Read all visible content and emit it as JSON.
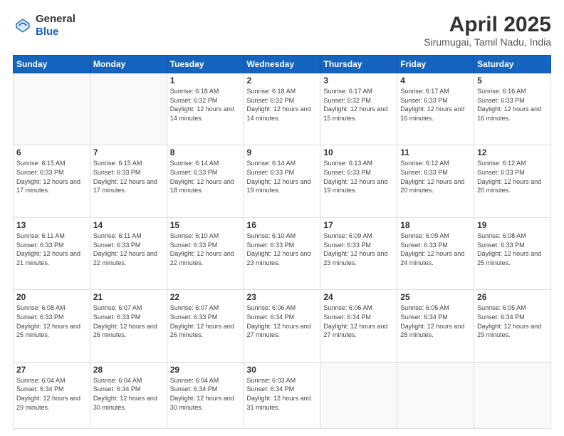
{
  "header": {
    "logo_general": "General",
    "logo_blue": "Blue",
    "title": "April 2025",
    "subtitle": "Sirumugai, Tamil Nadu, India"
  },
  "weekdays": [
    "Sunday",
    "Monday",
    "Tuesday",
    "Wednesday",
    "Thursday",
    "Friday",
    "Saturday"
  ],
  "weeks": [
    [
      {
        "day": "",
        "info": ""
      },
      {
        "day": "",
        "info": ""
      },
      {
        "day": "1",
        "info": "Sunrise: 6:18 AM\nSunset: 6:32 PM\nDaylight: 12 hours and 14 minutes."
      },
      {
        "day": "2",
        "info": "Sunrise: 6:18 AM\nSunset: 6:32 PM\nDaylight: 12 hours and 14 minutes."
      },
      {
        "day": "3",
        "info": "Sunrise: 6:17 AM\nSunset: 6:32 PM\nDaylight: 12 hours and 15 minutes."
      },
      {
        "day": "4",
        "info": "Sunrise: 6:17 AM\nSunset: 6:33 PM\nDaylight: 12 hours and 16 minutes."
      },
      {
        "day": "5",
        "info": "Sunrise: 6:16 AM\nSunset: 6:33 PM\nDaylight: 12 hours and 16 minutes."
      }
    ],
    [
      {
        "day": "6",
        "info": "Sunrise: 6:15 AM\nSunset: 6:33 PM\nDaylight: 12 hours and 17 minutes."
      },
      {
        "day": "7",
        "info": "Sunrise: 6:15 AM\nSunset: 6:33 PM\nDaylight: 12 hours and 17 minutes."
      },
      {
        "day": "8",
        "info": "Sunrise: 6:14 AM\nSunset: 6:33 PM\nDaylight: 12 hours and 18 minutes."
      },
      {
        "day": "9",
        "info": "Sunrise: 6:14 AM\nSunset: 6:33 PM\nDaylight: 12 hours and 19 minutes."
      },
      {
        "day": "10",
        "info": "Sunrise: 6:13 AM\nSunset: 6:33 PM\nDaylight: 12 hours and 19 minutes."
      },
      {
        "day": "11",
        "info": "Sunrise: 6:12 AM\nSunset: 6:33 PM\nDaylight: 12 hours and 20 minutes."
      },
      {
        "day": "12",
        "info": "Sunrise: 6:12 AM\nSunset: 6:33 PM\nDaylight: 12 hours and 20 minutes."
      }
    ],
    [
      {
        "day": "13",
        "info": "Sunrise: 6:11 AM\nSunset: 6:33 PM\nDaylight: 12 hours and 21 minutes."
      },
      {
        "day": "14",
        "info": "Sunrise: 6:11 AM\nSunset: 6:33 PM\nDaylight: 12 hours and 22 minutes."
      },
      {
        "day": "15",
        "info": "Sunrise: 6:10 AM\nSunset: 6:33 PM\nDaylight: 12 hours and 22 minutes."
      },
      {
        "day": "16",
        "info": "Sunrise: 6:10 AM\nSunset: 6:33 PM\nDaylight: 12 hours and 23 minutes."
      },
      {
        "day": "17",
        "info": "Sunrise: 6:09 AM\nSunset: 6:33 PM\nDaylight: 12 hours and 23 minutes."
      },
      {
        "day": "18",
        "info": "Sunrise: 6:09 AM\nSunset: 6:33 PM\nDaylight: 12 hours and 24 minutes."
      },
      {
        "day": "19",
        "info": "Sunrise: 6:08 AM\nSunset: 6:33 PM\nDaylight: 12 hours and 25 minutes."
      }
    ],
    [
      {
        "day": "20",
        "info": "Sunrise: 6:08 AM\nSunset: 6:33 PM\nDaylight: 12 hours and 25 minutes."
      },
      {
        "day": "21",
        "info": "Sunrise: 6:07 AM\nSunset: 6:33 PM\nDaylight: 12 hours and 26 minutes."
      },
      {
        "day": "22",
        "info": "Sunrise: 6:07 AM\nSunset: 6:33 PM\nDaylight: 12 hours and 26 minutes."
      },
      {
        "day": "23",
        "info": "Sunrise: 6:06 AM\nSunset: 6:34 PM\nDaylight: 12 hours and 27 minutes."
      },
      {
        "day": "24",
        "info": "Sunrise: 6:06 AM\nSunset: 6:34 PM\nDaylight: 12 hours and 27 minutes."
      },
      {
        "day": "25",
        "info": "Sunrise: 6:05 AM\nSunset: 6:34 PM\nDaylight: 12 hours and 28 minutes."
      },
      {
        "day": "26",
        "info": "Sunrise: 6:05 AM\nSunset: 6:34 PM\nDaylight: 12 hours and 29 minutes."
      }
    ],
    [
      {
        "day": "27",
        "info": "Sunrise: 6:04 AM\nSunset: 6:34 PM\nDaylight: 12 hours and 29 minutes."
      },
      {
        "day": "28",
        "info": "Sunrise: 6:04 AM\nSunset: 6:34 PM\nDaylight: 12 hours and 30 minutes."
      },
      {
        "day": "29",
        "info": "Sunrise: 6:04 AM\nSunset: 6:34 PM\nDaylight: 12 hours and 30 minutes."
      },
      {
        "day": "30",
        "info": "Sunrise: 6:03 AM\nSunset: 6:34 PM\nDaylight: 12 hours and 31 minutes."
      },
      {
        "day": "",
        "info": ""
      },
      {
        "day": "",
        "info": ""
      },
      {
        "day": "",
        "info": ""
      }
    ]
  ]
}
